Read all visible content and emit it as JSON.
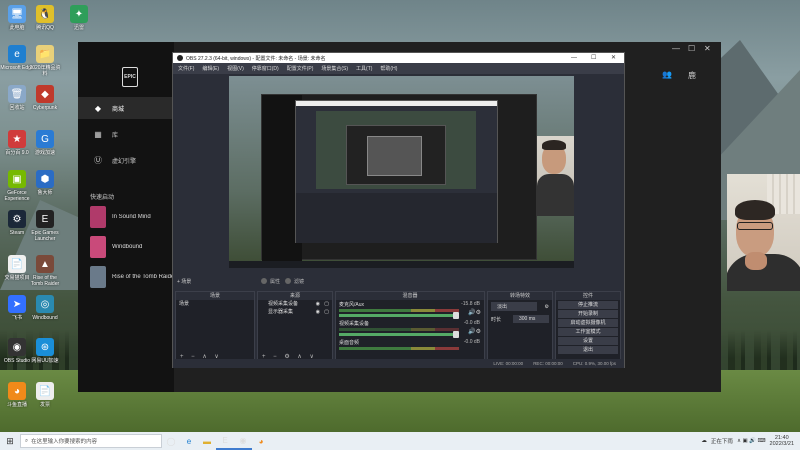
{
  "desktop": {
    "icons": [
      {
        "label": "此电脑",
        "color": "#5aa0e8",
        "glyph": "🖥"
      },
      {
        "label": "腾讯QQ",
        "color": "#e0c02a",
        "glyph": "🐧"
      },
      {
        "label": "迅雷",
        "color": "#2f9e5a",
        "glyph": "✦"
      },
      {
        "label": "Microsoft Edge",
        "color": "#1f7fd0",
        "glyph": "e"
      },
      {
        "label": "2020年精品资料",
        "color": "#e8d07a",
        "glyph": "📁"
      },
      {
        "label": "回收站",
        "color": "#8aa8c8",
        "glyph": "🗑"
      },
      {
        "label": "Cyberpunk",
        "color": "#c0392b",
        "glyph": "◆"
      },
      {
        "label": "百分百 9.0",
        "color": "#d03b3b",
        "glyph": "★"
      },
      {
        "label": "游戏加速",
        "color": "#2a7bd4",
        "glyph": "G"
      },
      {
        "label": "GeForce Experience",
        "color": "#76b900",
        "glyph": "▣"
      },
      {
        "label": "鲁大师",
        "color": "#2b6cc4",
        "glyph": "⬢"
      },
      {
        "label": "Steam",
        "color": "#1b2838",
        "glyph": "⚙"
      },
      {
        "label": "Epic Games Launcher",
        "color": "#222",
        "glyph": "E"
      },
      {
        "label": "交易猫项目",
        "color": "#f0f0f0",
        "glyph": "📄"
      },
      {
        "label": "Rise of the Tomb Raider",
        "color": "#7a4a3a",
        "glyph": "▲"
      },
      {
        "label": "飞书",
        "color": "#3370ff",
        "glyph": "➤"
      },
      {
        "label": "Windbound",
        "color": "#2a8ab0",
        "glyph": "◎"
      },
      {
        "label": "OBS Studio",
        "color": "#333",
        "glyph": "◉"
      },
      {
        "label": "网易UU加速",
        "color": "#1a8fd8",
        "glyph": "⊛"
      },
      {
        "label": "斗鱼直播",
        "color": "#f08a1a",
        "glyph": "◕"
      },
      {
        "label": "发票",
        "color": "#eeeeee",
        "glyph": "📄"
      }
    ]
  },
  "epic": {
    "logo": "EPIC",
    "nav": [
      {
        "label": "商城",
        "icon": "tag-icon",
        "glyph": "◆"
      },
      {
        "label": "库",
        "icon": "library-icon",
        "glyph": "▦"
      },
      {
        "label": "虚幻引擎",
        "icon": "unreal-icon",
        "glyph": "Ⓤ"
      }
    ],
    "quick_launch_label": "快速启动",
    "games": [
      {
        "name": "In Sound Mind",
        "color": "#b03a6a"
      },
      {
        "name": "Windbound",
        "color": "#c94a7a"
      },
      {
        "name": "Rise of the Tomb Raider",
        "color": "#6a7a8a"
      }
    ],
    "controls": {
      "minimize": "—",
      "maximize": "☐",
      "close": "✕"
    },
    "friends_glyph": "👥",
    "user_initial": "鹿"
  },
  "obs": {
    "title": "OBS 27.2.3 (64-bit, windows) - 配置文件: 未命名 - 场景: 未命名",
    "controls": {
      "minimize": "—",
      "maximize": "☐",
      "close": "✕"
    },
    "menu": [
      "文件(F)",
      "编辑(E)",
      "视图(V)",
      "停靠窗口(D)",
      "配置文件(P)",
      "场景集合(S)",
      "工具(T)",
      "帮助(H)"
    ],
    "add_scene_hint": "+ 场景",
    "tab_labels": [
      "属性",
      "滤镜"
    ],
    "docks": {
      "scenes": {
        "title": "场景",
        "items": [
          "场景"
        ]
      },
      "sources": {
        "title": "来源",
        "items": [
          "视频采集设备",
          "显示器采集"
        ]
      },
      "mixer": {
        "title": "混音器",
        "channels": [
          {
            "name": "麦克风/Aux",
            "db": "-15.8 dB"
          },
          {
            "name": "视频采集设备",
            "db": "-0.0 dB"
          },
          {
            "name": "桌面音频",
            "db": "-0.0 dB"
          }
        ]
      },
      "transitions": {
        "title": "转场特效",
        "type": "淡出",
        "duration_label": "时长",
        "duration": "300 ms"
      },
      "controls": {
        "title": "控件",
        "buttons": [
          "停止推流",
          "开始录制",
          "启动虚拟摄像机",
          "工作室模式",
          "设置",
          "退出"
        ]
      }
    },
    "status": {
      "live": "LIVE: 00:00:00",
      "rec": "REC: 00:00:00",
      "cpu": "CPU: 0.9%, 30.00 fps"
    }
  },
  "taskbar": {
    "search_placeholder": "在这里输入你要搜索的内容",
    "apps": [
      {
        "icon": "task-view-icon",
        "glyph": "◯"
      },
      {
        "icon": "edge-icon",
        "glyph": "e"
      },
      {
        "icon": "explorer-icon",
        "glyph": "▬"
      },
      {
        "icon": "epic-icon",
        "glyph": "E"
      },
      {
        "icon": "obs-icon",
        "glyph": "◉"
      },
      {
        "icon": "douyu-icon",
        "glyph": "◕"
      }
    ],
    "tray_text": "正在下雨",
    "time": "21:40",
    "date": "2022/3/21"
  }
}
